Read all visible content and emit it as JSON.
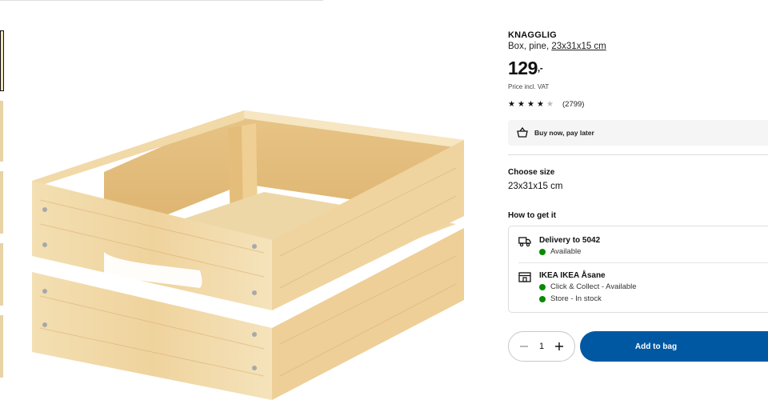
{
  "product": {
    "name": "KNAGGLIG",
    "description": "Box, pine,",
    "size_link": "23x31x15 cm",
    "price_int": "129",
    "price_dec": ",-",
    "vat_note": "Price incl. VAT",
    "rating": {
      "stars": 4.5,
      "count": "(2799)"
    }
  },
  "bnpl": {
    "label": "Buy now, pay later",
    "icon": "basket-icon"
  },
  "size": {
    "title": "Choose size",
    "value": "23x31x15 cm"
  },
  "fulfilment": {
    "title": "How to get it",
    "delivery": {
      "title": "Delivery to 5042",
      "status": "Available",
      "icon": "truck-icon"
    },
    "store": {
      "title": "IKEA IKEA Åsane",
      "lines": [
        "Click & Collect - Available",
        "Store - In stock"
      ],
      "icon": "store-icon"
    },
    "status_color": "#0a8a00"
  },
  "cart": {
    "quantity": "1",
    "add_label": "Add to bag",
    "accent": "#0058a3"
  },
  "thumbnails": {
    "count": 5,
    "active_index": 0
  }
}
